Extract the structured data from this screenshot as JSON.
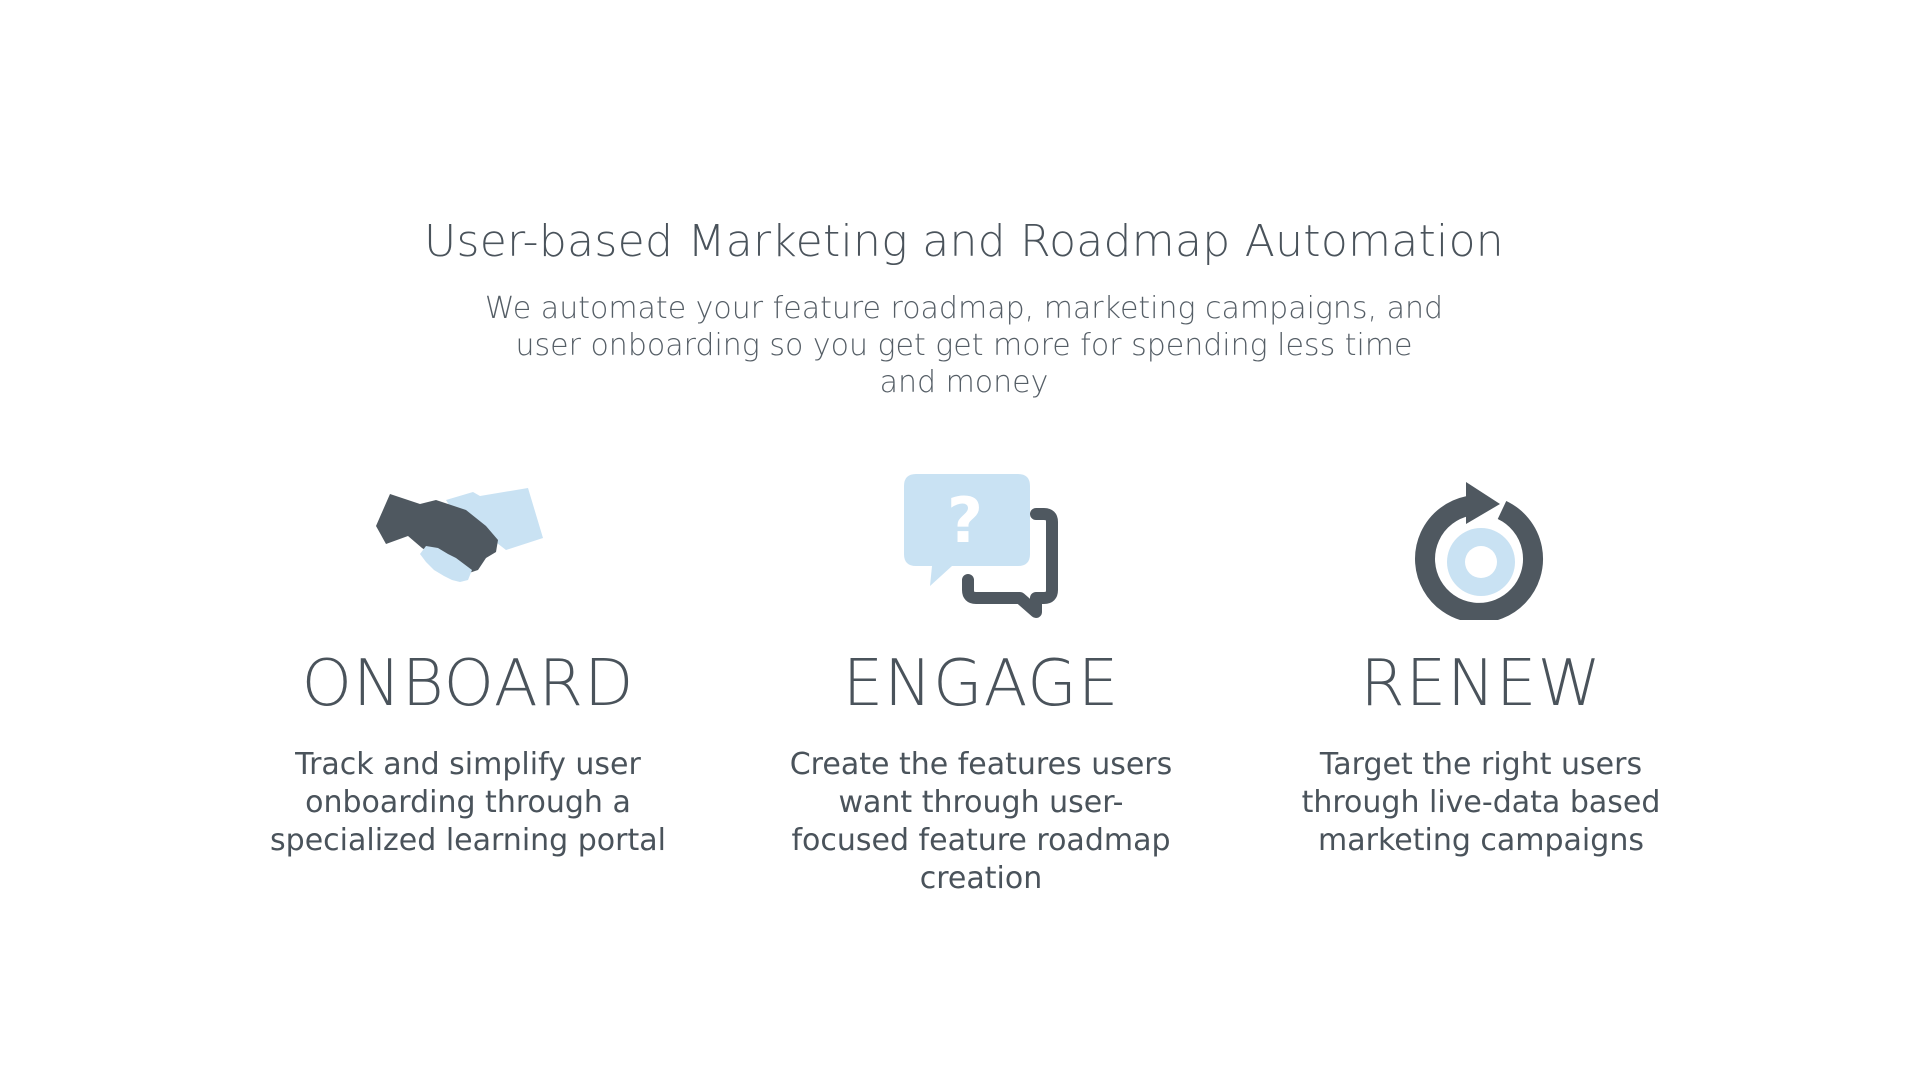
{
  "hero": {
    "title": "User-based Marketing and Roadmap Automation",
    "subtitle": "We automate your feature roadmap, marketing campaigns, and user onboarding so you get get more for spending less time and money"
  },
  "features": [
    {
      "icon": "handshake-icon",
      "title": "ONBOARD",
      "text": "Track and simplify user onboarding through a specialized learning portal"
    },
    {
      "icon": "question-chat-icon",
      "title": "ENGAGE",
      "text": "Create the features users want through user-focused feature roadmap creation"
    },
    {
      "icon": "renew-cycle-icon",
      "title": "RENEW",
      "text": "Target the right users through live-data based marketing campaigns"
    }
  ],
  "colors": {
    "dark": "#4f5860",
    "light": "#c9e2f3",
    "text": "#4a535b",
    "background": "#ffffff"
  }
}
